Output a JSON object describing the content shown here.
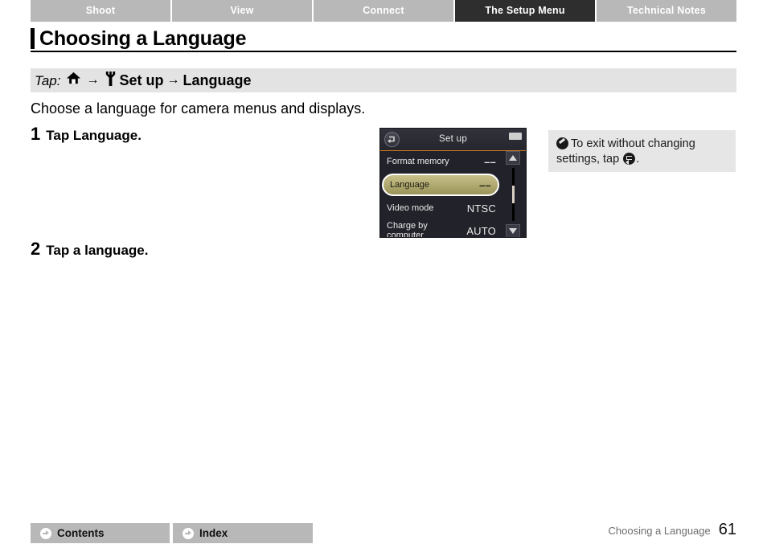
{
  "tabs": [
    {
      "label": "Shoot",
      "active": false
    },
    {
      "label": "View",
      "active": false
    },
    {
      "label": "Connect",
      "active": false
    },
    {
      "label": "The Setup Menu",
      "active": true
    },
    {
      "label": "Technical Notes",
      "active": false
    }
  ],
  "page": {
    "title": "Choosing a Language",
    "path_label": "Tap:",
    "path_home_icon": "home-icon",
    "path_wrench_icon": "wrench-icon",
    "path_arrow": "→",
    "path_segment_1": "Set up",
    "path_segment_2": "Language",
    "intro": "Choose a language for camera menus and displays."
  },
  "steps": [
    {
      "number": "1",
      "text": "Tap Language."
    },
    {
      "number": "2",
      "text": "Tap a language."
    }
  ],
  "lcd": {
    "back_icon": "back-arrow-icon",
    "battery_icon": "battery-icon",
    "title": "Set up",
    "rows": [
      {
        "label": "Format memory",
        "value": "––",
        "selected": false
      },
      {
        "label": "Language",
        "value": "––",
        "selected": true
      },
      {
        "label": "Video mode",
        "value": "NTSC",
        "selected": false
      },
      {
        "label": "Charge by computer",
        "value": "AUTO",
        "selected": false
      }
    ],
    "scroll_up_icon": "triangle-up-icon",
    "scroll_down_icon": "triangle-down-icon"
  },
  "note": {
    "icon": "note-pencil-icon",
    "text_before": "To exit without changing settings, tap",
    "inline_icon": "back-arrow-icon",
    "text_after": "."
  },
  "footer": {
    "contents_label": "Contents",
    "index_label": "Index",
    "chapter": "Choosing a Language",
    "page_number": "61"
  },
  "colors": {
    "tab_inactive_bg": "#b8b8b8",
    "tab_active_bg": "#2e2e2e",
    "path_bar_bg": "#e3e3e3",
    "note_bg": "#e6e6e6",
    "lcd_bg": "#22222a",
    "lcd_accent": "#d07a22",
    "lcd_selected": "#9a9459"
  }
}
